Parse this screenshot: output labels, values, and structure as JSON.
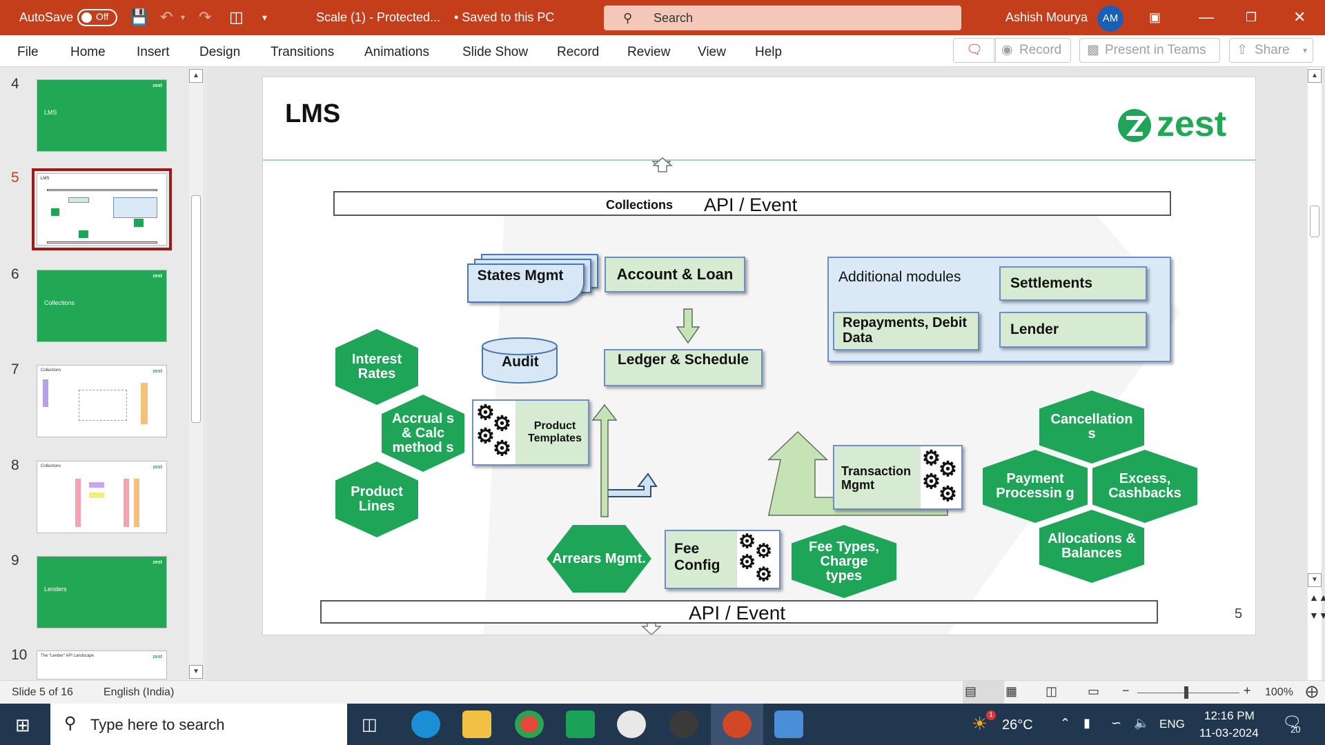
{
  "titlebar": {
    "autosave": "AutoSave",
    "doc_title": "Scale (1)  -  Protected...",
    "saved_status": "• Saved to this PC",
    "search_placeholder": "Search",
    "user_name": "Ashish Mourya",
    "user_initials": "AM"
  },
  "ribbon": {
    "tabs": [
      "File",
      "Home",
      "Insert",
      "Design",
      "Transitions",
      "Animations",
      "Slide Show",
      "Record",
      "Review",
      "View",
      "Help"
    ],
    "record_label": "Record",
    "present_label": "Present in Teams",
    "share_label": "Share"
  },
  "thumbnails": [
    {
      "num": "4",
      "title": "LMS",
      "logo": "zest"
    },
    {
      "num": "5",
      "title": "LMS",
      "logo": "zest"
    },
    {
      "num": "6",
      "title": "Collections",
      "logo": "zest"
    },
    {
      "num": "7",
      "title": "Collections",
      "logo": "zest"
    },
    {
      "num": "8",
      "title": "Collections",
      "logo": "zest"
    },
    {
      "num": "9",
      "title": "Lenders",
      "logo": "zest"
    },
    {
      "num": "10",
      "title": "The \"Lender\" API Landscape",
      "logo": "zest"
    }
  ],
  "slide": {
    "title": "LMS",
    "logo": "zest",
    "page_number": "5",
    "top_bar_left": "Collections",
    "top_bar": "API / Event",
    "bottom_bar": "API / Event",
    "states_mgmt": "States Mgmt",
    "account_loan": "Account & Loan",
    "additional_modules": "Additional modules",
    "settlements": "Settlements",
    "repayments": "Repayments, Debit Data",
    "lender": "Lender",
    "audit": "Audit",
    "ledger_schedule": "Ledger & Schedule",
    "interest_rates": "Interest Rates",
    "accruals": "Accrual s & Calc method s",
    "product_templates": "Product Templates",
    "product_lines": "Product Lines",
    "transaction_mgmt": "Transaction Mgmt",
    "cancellations": "Cancellation s",
    "payment_processing": "Payment Processin g",
    "excess_cashbacks": "Excess, Cashbacks",
    "allocations": "Allocations & Balances",
    "arrears": "Arrears Mgmt.",
    "fee_config": "Fee Config",
    "fee_types": "Fee Types, Charge types"
  },
  "statusbar": {
    "slide_info": "Slide 5 of 16",
    "language": "English (India)",
    "zoom": "100%"
  },
  "taskbar": {
    "search_placeholder": "Type here to search",
    "weather": "26°C",
    "language": "ENG",
    "time": "12:16 PM",
    "date": "11-03-2024",
    "notifications": "20",
    "weather_badge": "1"
  },
  "colors": {
    "accent": "#c43e1c",
    "zest_green": "#1ea558",
    "box_fill": "#d7ebd2",
    "box_border": "#6d8fc8"
  }
}
